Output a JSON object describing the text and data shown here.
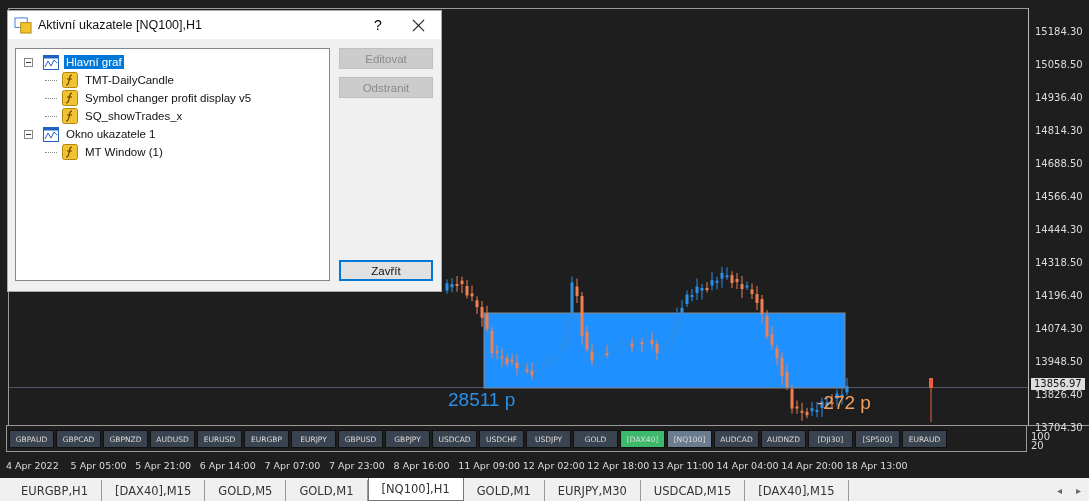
{
  "dialog": {
    "title": "Aktivní ukazatele [NQ100],H1",
    "help": "?",
    "tree": [
      {
        "label": "Hlavní graf",
        "kind": "window",
        "selected": true,
        "expanded": true,
        "children": [
          {
            "label": "TMT-DailyCandle",
            "kind": "indicator",
            "selected": false
          },
          {
            "label": "Symbol changer profit display v5",
            "kind": "indicator",
            "selected": false
          },
          {
            "label": "SQ_showTrades_x",
            "kind": "indicator",
            "selected": false
          }
        ]
      },
      {
        "label": "Okno ukazatele 1",
        "kind": "window",
        "selected": false,
        "expanded": true,
        "children": [
          {
            "label": "MT Window (1)",
            "kind": "indicator",
            "selected": false
          }
        ]
      }
    ],
    "buttons": [
      {
        "label": "Editovat",
        "disabled": true
      },
      {
        "label": "Odstranit",
        "disabled": true
      }
    ],
    "close_button": "Zavřít"
  },
  "chart": {
    "price_labels": [
      "15184.30",
      "15058.50",
      "14936.40",
      "14814.30",
      "14688.50",
      "14566.40",
      "14444.30",
      "14318.50",
      "14196.40",
      "14074.30",
      "13948.50",
      "13826.40",
      "13704.30"
    ],
    "current_price": "13856.97",
    "profit_labels": [
      {
        "text": "28511 p",
        "color": "#2b8fe8"
      },
      {
        "text": "-272 p",
        "color": "#f0a060"
      }
    ],
    "symbols": [
      {
        "label": "GBPAUD",
        "color": "#3a4350"
      },
      {
        "label": "GBPCAD",
        "color": "#3a4350"
      },
      {
        "label": "GBPNZD",
        "color": "#3a4350"
      },
      {
        "label": "AUDUSD",
        "color": "#3a4350"
      },
      {
        "label": "EURUSD",
        "color": "#3a4350"
      },
      {
        "label": "EURGBP",
        "color": "#3a4350"
      },
      {
        "label": "EURJPY",
        "color": "#3a4350"
      },
      {
        "label": "GBPUSD",
        "color": "#3a4350"
      },
      {
        "label": "GBPJPY",
        "color": "#3a4350"
      },
      {
        "label": "USDCAD",
        "color": "#3a4350"
      },
      {
        "label": "USDCHF",
        "color": "#3a4350"
      },
      {
        "label": "USDJPY",
        "color": "#3a4350"
      },
      {
        "label": "GOLD",
        "color": "#3a4350"
      },
      {
        "label": "[DAX40]",
        "color": "#3cb96a"
      },
      {
        "label": "[NQ100]",
        "color": "#6b7c8f"
      },
      {
        "label": "AUDCAD",
        "color": "#3a4350"
      },
      {
        "label": "AUDNZD",
        "color": "#3a4350"
      },
      {
        "label": "[DJI30]",
        "color": "#3a4350"
      },
      {
        "label": "[SP500]",
        "color": "#3a4350"
      },
      {
        "label": "EURAUD",
        "color": "#3a4350"
      }
    ],
    "sub_labels": [
      "100",
      "20"
    ],
    "time_labels": [
      "4 Apr 2022",
      "5 Apr 05:00",
      "5 Apr 21:00",
      "6 Apr 14:00",
      "7 Apr 07:00",
      "7 Apr 23:00",
      "8 Apr 16:00",
      "11 Apr 09:00",
      "12 Apr 02:00",
      "12 Apr 18:00",
      "13 Apr 11:00",
      "14 Apr 04:00",
      "14 Apr 20:00",
      "18 Apr 13:00"
    ]
  },
  "tab_scroll": [
    "◂",
    "▸"
  ],
  "tabs": [
    {
      "label": "EURGBP,H1",
      "selected": false
    },
    {
      "label": "[DAX40],M15",
      "selected": false
    },
    {
      "label": "GOLD,M5",
      "selected": false
    },
    {
      "label": "GOLD,M1",
      "selected": false
    },
    {
      "label": "[NQ100],H1",
      "selected": true
    },
    {
      "label": "GOLD,M1",
      "selected": false
    },
    {
      "label": "EURJPY,M30",
      "selected": false
    },
    {
      "label": "USDCAD,M15",
      "selected": false
    },
    {
      "label": "[DAX40],M15",
      "selected": false
    }
  ]
}
